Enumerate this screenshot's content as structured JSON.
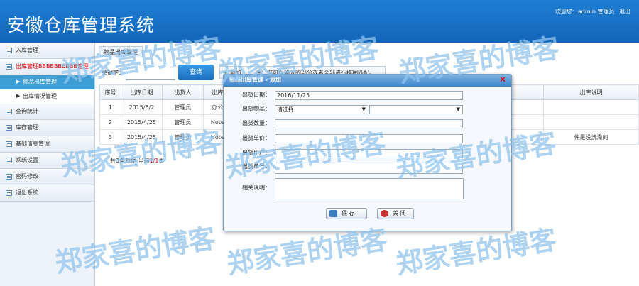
{
  "header": {
    "title": "安徽仓库管理系统",
    "welcome": "欢迎您：admin 管理员",
    "logout": "退出"
  },
  "sidebar": {
    "items": [
      {
        "label": "入库管理"
      },
      {
        "label": "出库管理BBBBBBBBBB管理"
      },
      {
        "label": "查询统计"
      },
      {
        "label": "库存管理"
      },
      {
        "label": "基础信息管理"
      },
      {
        "label": "系统设置"
      },
      {
        "label": "密码修改"
      },
      {
        "label": "退出系统"
      }
    ],
    "subitems": [
      {
        "label": "物品出库管理"
      },
      {
        "label": "出库情况管理"
      }
    ]
  },
  "main": {
    "tab": "物品出库管理",
    "keyword_label": "关键字：",
    "query_button": "查询",
    "add_label": "添加",
    "note": "注：您可以输入的部分或者全部进行模糊匹配。",
    "columns": [
      "序号",
      "出库日期",
      "出货人",
      "出库",
      "出库说明"
    ],
    "rows": [
      [
        "1",
        "2015/5/2",
        "管理员",
        "办公",
        ""
      ],
      [
        "2",
        "2015/4/25",
        "管理员",
        "Note",
        ""
      ],
      [
        "3",
        "2015/4/25",
        "管理员",
        "Note",
        "件是没洗澡的"
      ]
    ],
    "pager": {
      "prefix": "共3条数据 当前",
      "current": "1/1",
      "suffix": "页"
    }
  },
  "dialog": {
    "title": "物品出库管理 - 添加",
    "labels": {
      "date": "出货日期：",
      "item": "出货物品：",
      "quantity": "出货数量：",
      "price": "出货单价：",
      "user": "出货用户：",
      "number": "出货单号：",
      "desc": "相关说明："
    },
    "date_value": "2016/11/25",
    "item_select": "请选择",
    "save_label": "保 存",
    "close_label": "关 闭"
  },
  "watermark": "郑家喜的博客",
  "colors": {
    "header_blue": "#1f7fd3",
    "active_menu_red": "#d40000",
    "active_sub_blue": "#3d9ed6",
    "watermark": "#92c4ec"
  }
}
